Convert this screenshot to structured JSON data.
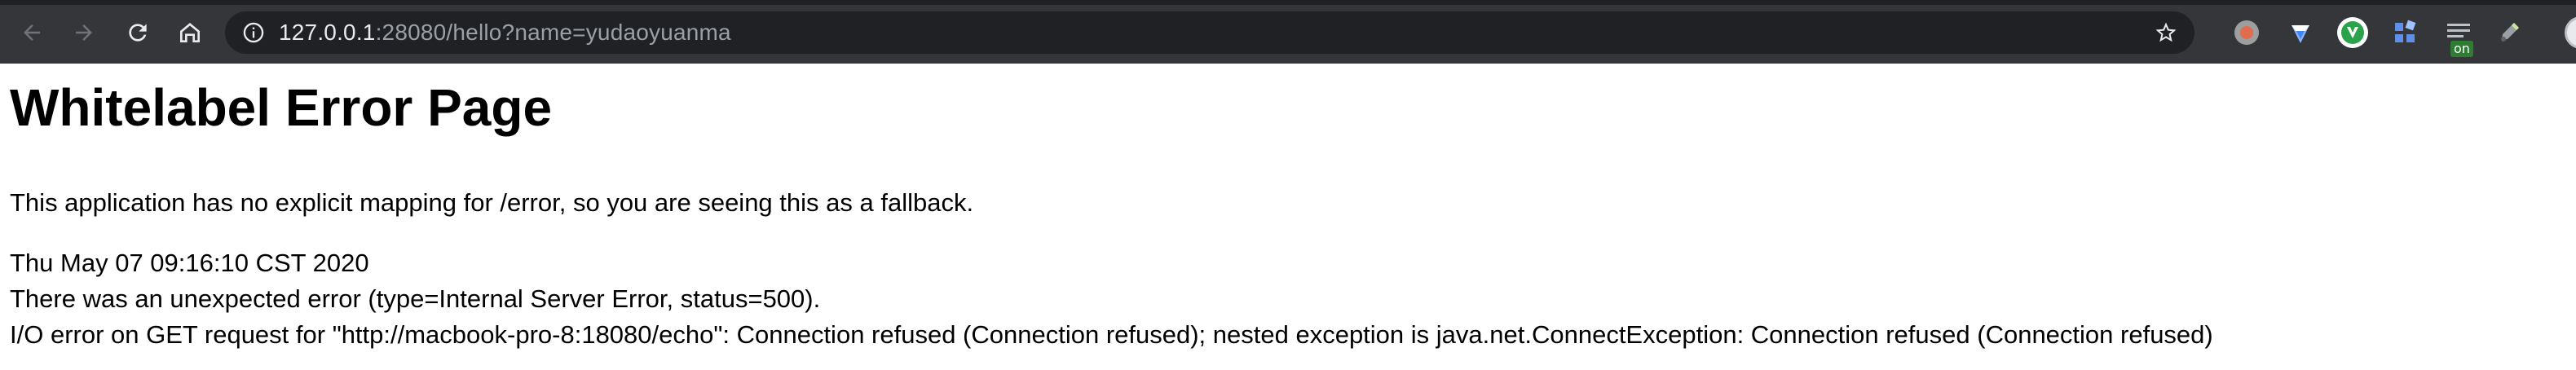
{
  "browser": {
    "url_host": "127.0.0.1",
    "url_rest": ":28080/hello?name=yudaoyuanma",
    "buttons": {
      "back_icon": "arrow-left-icon",
      "forward_icon": "arrow-right-icon",
      "reload_icon": "reload-icon",
      "home_icon": "home-icon",
      "site_info_icon": "info-circle-icon",
      "bookmark_icon": "star-outline-icon"
    },
    "extensions": [
      {
        "icon": "record-circle-icon"
      },
      {
        "icon": "diamond-shield-icon"
      },
      {
        "icon": "green-v-circle-icon"
      },
      {
        "icon": "puzzle-blocks-icon"
      },
      {
        "icon": "list-lines-icon",
        "badge": "on"
      },
      {
        "icon": "pen-eraser-icon"
      }
    ],
    "colors": {
      "toolbar": "#35363a",
      "omnibox": "#202124",
      "url_host": "#e8eaed",
      "url_path": "#9aa0a6"
    }
  },
  "page": {
    "title": "Whitelabel Error Page",
    "description": "This application has no explicit mapping for /error, so you are seeing this as a fallback.",
    "timestamp": "Thu May 07 09:16:10 CST 2020",
    "error_type": "There was an unexpected error (type=Internal Server Error, status=500).",
    "error_detail": "I/O error on GET request for \"http://macbook-pro-8:18080/echo\": Connection refused (Connection refused); nested exception is java.net.ConnectException: Connection refused (Connection refused)"
  }
}
